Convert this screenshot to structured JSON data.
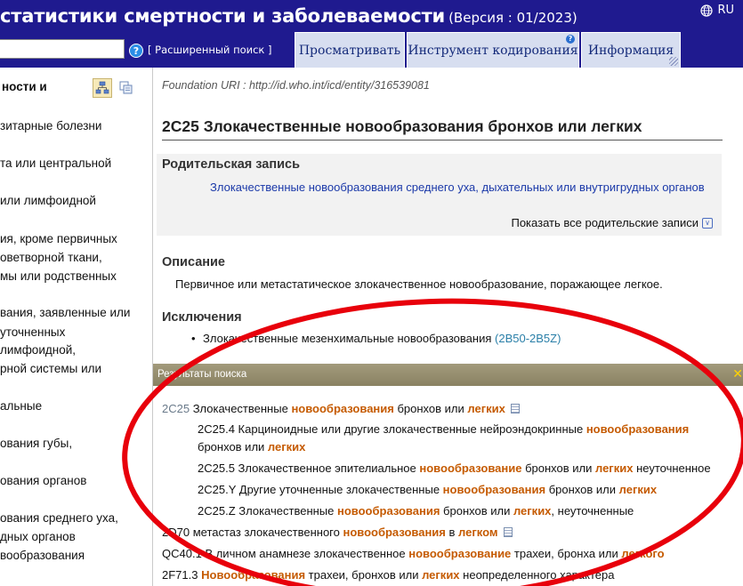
{
  "header": {
    "title": "статистики смертности и заболеваемости",
    "version": "(Версия : 01/2023)",
    "language": "RU",
    "search_value": "",
    "help_symbol": "?",
    "advanced_search": "[ Расширенный поиск ]",
    "tabs": [
      {
        "label": "Просматривать"
      },
      {
        "label": "Инструмент кодирования",
        "badge": "?"
      },
      {
        "label": "Информация"
      }
    ]
  },
  "tree": {
    "root": "ности и",
    "items": [
      {
        "label": "зитарные болезни"
      },
      {
        "label": "та или центральной"
      },
      {
        "label": "или лимфоидной"
      },
      {
        "label": "ия, кроме первичных"
      },
      {
        "label": "оветворной ткани,"
      },
      {
        "label": "мы или родственных"
      },
      {
        "label": "вания, заявленные или"
      },
      {
        "label": "уточненных"
      },
      {
        "label": "лимфоидной,"
      },
      {
        "label": "рной системы или"
      },
      {
        "label": "альные"
      },
      {
        "label": "ования губы,"
      },
      {
        "label": "ования органов"
      },
      {
        "label": "ования среднего уха,"
      },
      {
        "label": "дных органов"
      },
      {
        "label": "вообразования"
      }
    ]
  },
  "entity": {
    "uri": "Foundation URI : http://id.who.int/icd/entity/316539081",
    "title": "2C25 Злокачественные новообразования бронхов или легких",
    "parent_heading": "Родительская запись",
    "parent_link": "Злокачественные новообразования среднего уха, дыхательных или внутригрудных органов",
    "show_all_parents": "Показать все родительские записи",
    "description_heading": "Описание",
    "description": "Первичное или метастатическое злокачественное новообразование, поражающее легкое.",
    "exclusions_heading": "Исключения",
    "exclusion_text": "Злокачественные мезенхимальные новообразования",
    "exclusion_code": "(2B50-2B5Z)"
  },
  "results": {
    "title": "Результаты поиска",
    "close": "x",
    "rows": [
      {
        "code": "2C25",
        "parts": [
          "Злокачественные ",
          "новообразования",
          " бронхов или ",
          "легких",
          ""
        ]
      },
      {
        "code": "2C25.4",
        "parts": [
          "Карциноидные или другие злокачественные нейроэндокринные ",
          "новообразования",
          "",
          "",
          ""
        ]
      },
      {
        "code": "",
        "parts": [
          "бронхов или ",
          "легких",
          "",
          "",
          ""
        ]
      },
      {
        "code": "2C25.5",
        "parts": [
          "Злокачественное эпителиальное ",
          "новообразование",
          " бронхов или ",
          "легких",
          " неуточненное"
        ]
      },
      {
        "code": "2C25.Y",
        "parts": [
          "Другие уточненные злокачественные ",
          "новообразования",
          " бронхов или ",
          "легких",
          ""
        ]
      },
      {
        "code": "2C25.Z",
        "parts": [
          "Злокачественные ",
          "новообразования",
          " бронхов или ",
          "легких",
          ", неуточненные"
        ]
      },
      {
        "code": "2D70",
        "parts": [
          "метастаз злокачественного ",
          "новообразования",
          " в ",
          "легком",
          ""
        ]
      },
      {
        "code": "QC40.1",
        "parts": [
          "В личном анамнезе злокачественное ",
          "новообразование",
          " трахеи, бронха или ",
          "легкого",
          ""
        ]
      },
      {
        "code": "2F71.3",
        "parts": [
          "",
          "Новообразования",
          " трахеи, бронхов или ",
          "легких",
          " неопределенного характера"
        ]
      }
    ]
  },
  "colors": {
    "header_bg": "#1f1a8f",
    "tab_bg": "#d7def0",
    "highlight": "#c55a00",
    "link": "#1c3aa9",
    "annotation": "#e8000b"
  },
  "icons": [
    "globe-icon",
    "help-icon",
    "tree-view-icon",
    "copy-view-icon",
    "chevron-down-icon",
    "document-icon",
    "close-icon"
  ]
}
